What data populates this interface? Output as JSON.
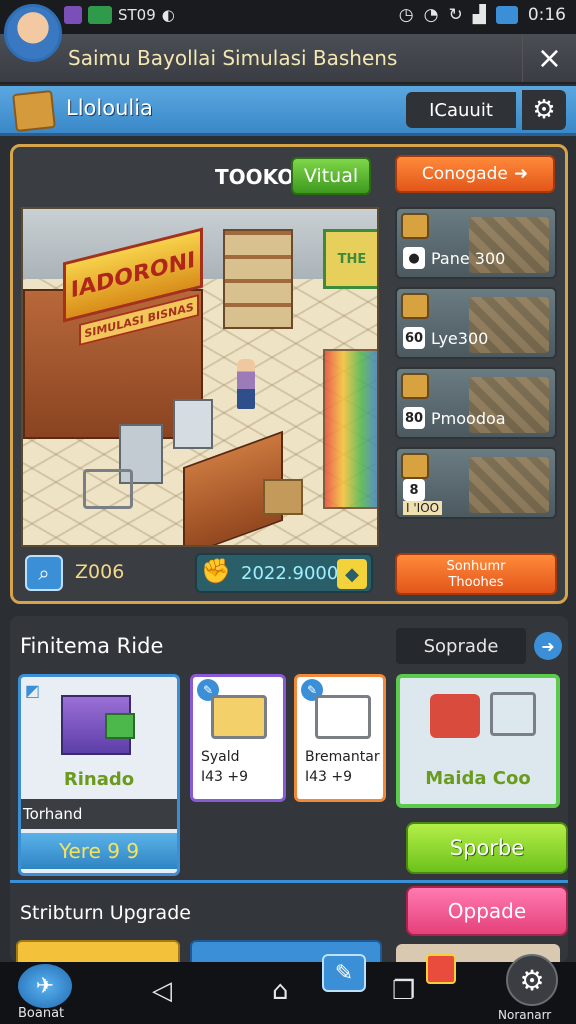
{
  "status_bar": {
    "left_text": "ЅТ09",
    "time": "0:16"
  },
  "title_bar": {
    "title": "Saimu Bayollai Simulasi Bashens",
    "close_icon": "×"
  },
  "header": {
    "title": "Lloloulia",
    "account_label": "ICauuit",
    "gear_icon": "⚙"
  },
  "shop": {
    "name": "TOOKO",
    "mode_button": "Vitual",
    "sign_main": "IADORONI",
    "sign_sub": "SIMULASI BISNAS"
  },
  "side": {
    "top_button": "Conogade",
    "cards": [
      {
        "icon": "●",
        "label": "Pane 300"
      },
      {
        "icon": "60",
        "label": "Lye300"
      },
      {
        "icon": "80",
        "label": "Pmoodoa"
      },
      {
        "icon": "8",
        "label": "",
        "sub": "I 'IOO"
      }
    ],
    "bottom_button_line1": "Sonhumr",
    "bottom_button_line2": "Thoohes"
  },
  "stats": {
    "value_left": "Z006",
    "coins": "2022.9000"
  },
  "lower": {
    "section_title": "Finitema Ride",
    "sortrade": "Soprade",
    "card1": {
      "name": "Rinado",
      "subtitle": "Torhand",
      "price": "Yere 9 9"
    },
    "card2": {
      "line1": "Syald",
      "line2": "I43 +9"
    },
    "card3": {
      "line1": "Bremantar",
      "line2": "I43 +9"
    },
    "card4": {
      "name": "Maida Coo"
    },
    "green_button": "Sporbe",
    "section2_title": "Stribturn Upgrade",
    "pink_button": "Oppade"
  },
  "navbar": {
    "boost_label": "Boanat",
    "settings_label": "Noranarr"
  }
}
